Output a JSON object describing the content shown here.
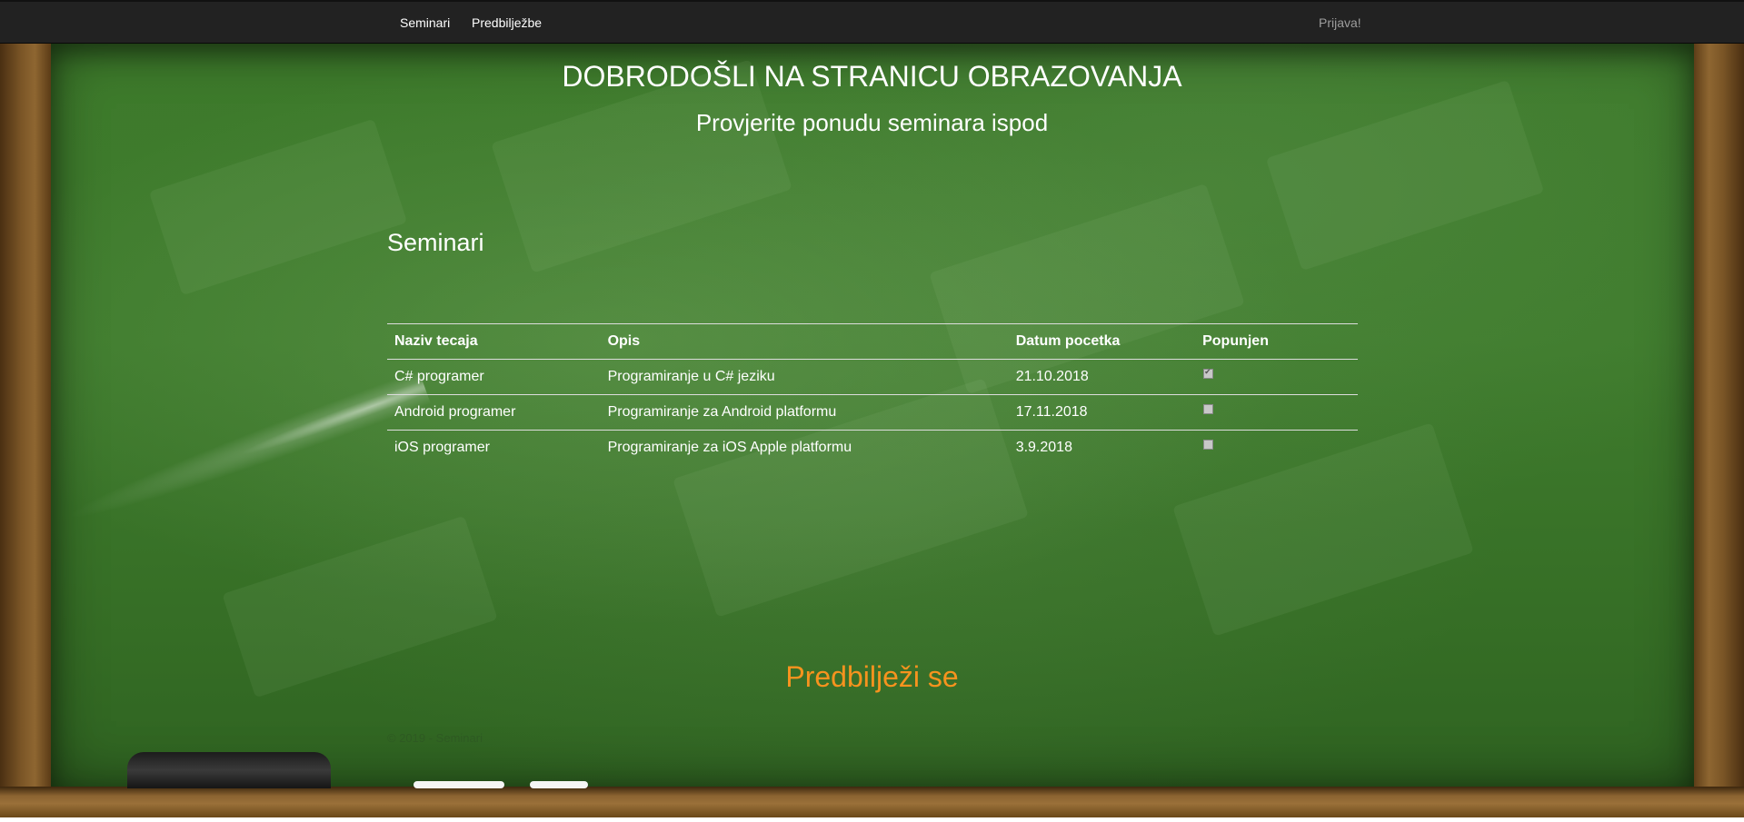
{
  "nav": {
    "seminari": "Seminari",
    "predbiljezbe": "Predbilježbe",
    "prijava": "Prijava!"
  },
  "header": {
    "title": "DOBRODOŠLI NA STRANICU OBRAZOVANJA",
    "subtitle": "Provjerite ponudu seminara ispod"
  },
  "section": {
    "title": "Seminari"
  },
  "table": {
    "columns": [
      "Naziv tecaja",
      "Opis",
      "Datum pocetka",
      "Popunjen"
    ],
    "rows": [
      {
        "naziv": "C# programer",
        "opis": "Programiranje u C# jeziku",
        "datum": "21.10.2018",
        "popunjen": true
      },
      {
        "naziv": "Android programer",
        "opis": "Programiranje za Android platformu",
        "datum": "17.11.2018",
        "popunjen": false
      },
      {
        "naziv": "iOS programer",
        "opis": "Programiranje za iOS Apple platformu",
        "datum": "3.9.2018",
        "popunjen": false
      }
    ]
  },
  "cta": {
    "label": "Predbilježi se"
  },
  "footer": {
    "text": "© 2019 - Seminari"
  },
  "colors": {
    "navbar": "#222222",
    "board_green": "#3d7a2b",
    "cta_orange": "#f7931e"
  }
}
